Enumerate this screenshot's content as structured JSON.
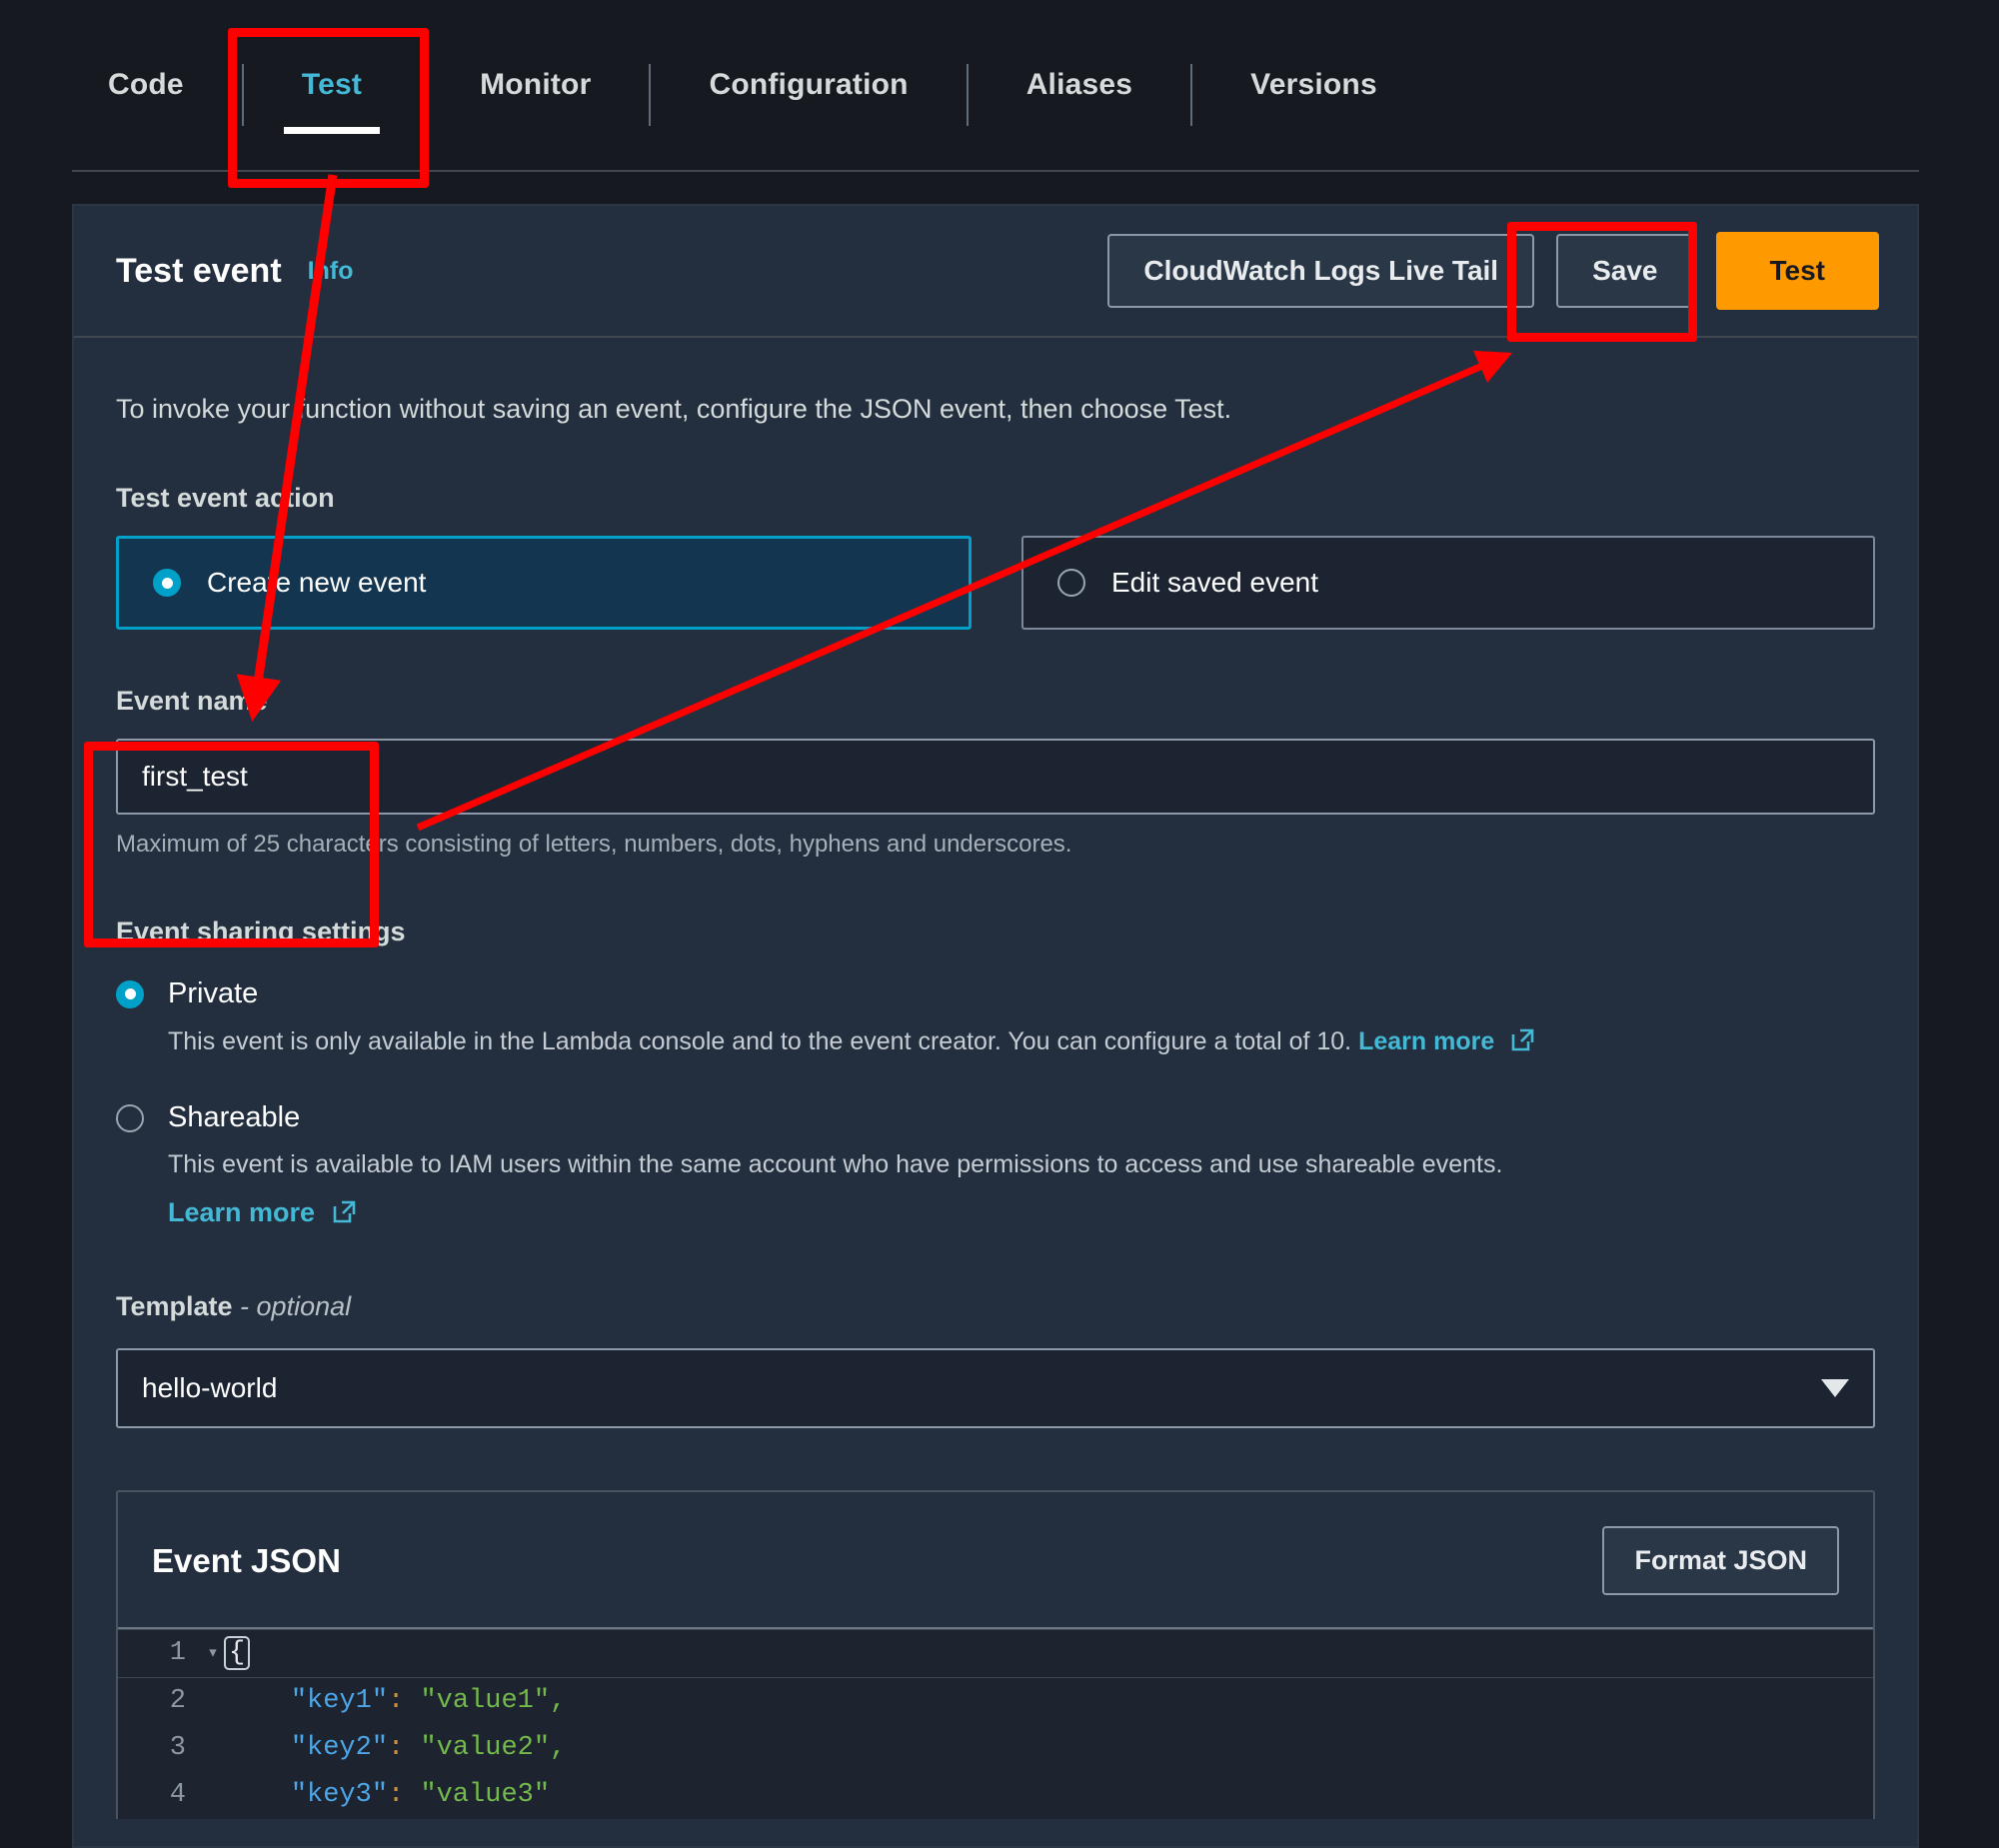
{
  "tabs": [
    {
      "label": "Code",
      "active": false
    },
    {
      "label": "Test",
      "active": true
    },
    {
      "label": "Monitor",
      "active": false
    },
    {
      "label": "Configuration",
      "active": false
    },
    {
      "label": "Aliases",
      "active": false
    },
    {
      "label": "Versions",
      "active": false
    }
  ],
  "panel": {
    "title": "Test event",
    "info_label": "Info",
    "actions": {
      "live_tail": "CloudWatch Logs Live Tail",
      "save": "Save",
      "test": "Test"
    },
    "intro": "To invoke your function without saving an event, configure the JSON event, then choose Test."
  },
  "test_event_action": {
    "label": "Test event action",
    "options": [
      {
        "label": "Create new event",
        "selected": true
      },
      {
        "label": "Edit saved event",
        "selected": false
      }
    ]
  },
  "event_name": {
    "label": "Event name",
    "value": "first_test",
    "placeholder": "",
    "helper": "Maximum of 25 characters consisting of letters, numbers, dots, hyphens and underscores."
  },
  "sharing": {
    "label": "Event sharing settings",
    "private": {
      "name": "Private",
      "selected": true,
      "desc": "This event is only available in the Lambda console and to the event creator. You can configure a total of 10.",
      "link": "Learn more"
    },
    "shareable": {
      "name": "Shareable",
      "selected": false,
      "desc": "This event is available to IAM users within the same account who have permissions to access and use shareable events.",
      "link": "Learn more"
    }
  },
  "template": {
    "label": "Template",
    "optional_suffix": "- optional",
    "value": "hello-world"
  },
  "event_json": {
    "title": "Event JSON",
    "format_button": "Format JSON",
    "lines": [
      {
        "number": "1",
        "foldable": true,
        "brace": "{",
        "key": "",
        "value": "",
        "comma": ""
      },
      {
        "number": "2",
        "foldable": false,
        "brace": "",
        "key": "key1",
        "value": "value1",
        "comma": ","
      },
      {
        "number": "3",
        "foldable": false,
        "brace": "",
        "key": "key2",
        "value": "value2",
        "comma": ","
      },
      {
        "number": "4",
        "foldable": false,
        "brace": "",
        "key": "key3",
        "value": "value3",
        "comma": ""
      }
    ]
  },
  "colors": {
    "accent": "#ff9900",
    "link": "#44b9d6",
    "selected_tile_border": "#00a1c9",
    "annotation": "#fe0000",
    "panel_bg": "#232f3e",
    "page_bg": "#16191f"
  },
  "annotations": {
    "box_test_tab": "highlight-test-tab",
    "box_save_button": "highlight-save-button",
    "box_event_name": "highlight-event-name-field",
    "arrow_to_create_new_event": "arrow-test-tab-to-create-new-event",
    "arrow_to_save": "arrow-event-name-to-save-button"
  }
}
